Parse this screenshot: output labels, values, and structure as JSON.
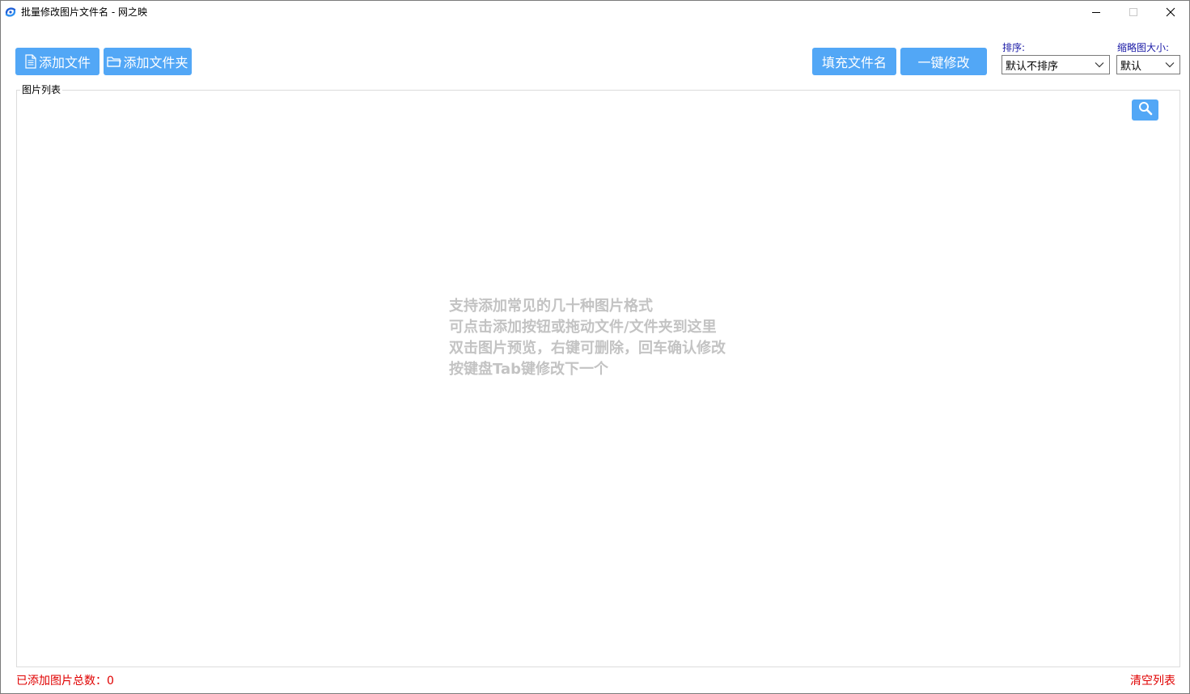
{
  "window": {
    "title": "批量修改图片文件名 - 网之映",
    "minimize_icon": "minimize-icon",
    "maximize_icon": "maximize-icon",
    "close_icon": "close-icon"
  },
  "toolbar": {
    "add_file_label": "添加文件",
    "add_folder_label": "添加文件夹",
    "fill_name_label": "填充文件名",
    "one_click_label": "一键修改",
    "sort_label": "排序:",
    "sort_value": "默认不排序",
    "thumb_label": "缩略图大小:",
    "thumb_value": "默认"
  },
  "image_list": {
    "group_title": "图片列表",
    "search_icon": "search-icon",
    "hint_lines": [
      "支持添加常见的几十种图片格式",
      "可点击添加按钮或拖动文件/文件夹到这里",
      "双击图片预览，右键可删除，回车确认修改",
      "按键盘Tab键修改下一个"
    ]
  },
  "status": {
    "total_text": "已添加图片总数：0",
    "clear_list_label": "清空列表"
  },
  "colors": {
    "accent": "#52a7f6",
    "label_blue": "#1a1aa6",
    "status_red": "#e00000",
    "hint_gray": "#c3c3c3"
  }
}
